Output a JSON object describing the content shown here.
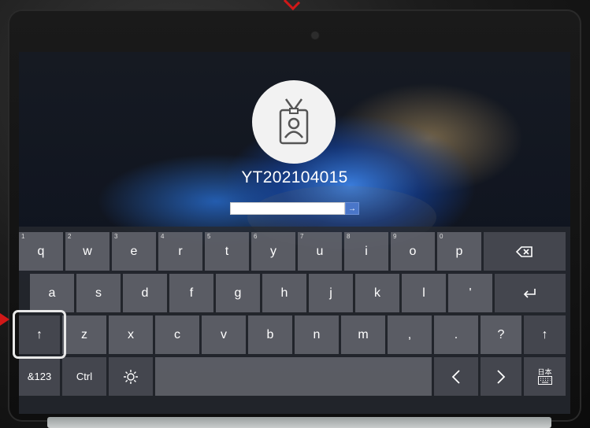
{
  "login": {
    "username": "YT202104015",
    "password_value": "",
    "submit_icon": "arrow-right-icon"
  },
  "keyboard": {
    "row1": [
      {
        "label": "q",
        "hint": "1"
      },
      {
        "label": "w",
        "hint": "2"
      },
      {
        "label": "e",
        "hint": "3"
      },
      {
        "label": "r",
        "hint": "4"
      },
      {
        "label": "t",
        "hint": "5"
      },
      {
        "label": "y",
        "hint": "6"
      },
      {
        "label": "u",
        "hint": "7"
      },
      {
        "label": "i",
        "hint": "8"
      },
      {
        "label": "o",
        "hint": "9"
      },
      {
        "label": "p",
        "hint": "0"
      }
    ],
    "row2": [
      "a",
      "s",
      "d",
      "f",
      "g",
      "h",
      "j",
      "k",
      "l",
      "'"
    ],
    "row3": [
      "z",
      "x",
      "c",
      "v",
      "b",
      "n",
      "m",
      ",",
      ".",
      "?"
    ],
    "symbols_label": "&123",
    "ctrl_label": "Ctrl",
    "ime_label": "日本",
    "icons": {
      "backspace": "backspace-icon",
      "enter": "enter-icon",
      "shift": "shift-arrow-up-icon",
      "brightness": "sun-icon",
      "left": "chevron-left-icon",
      "right": "chevron-right-icon",
      "keyboard": "keyboard-icon"
    }
  },
  "colors": {
    "marker": "#d01818",
    "submit": "#4a76c9"
  }
}
